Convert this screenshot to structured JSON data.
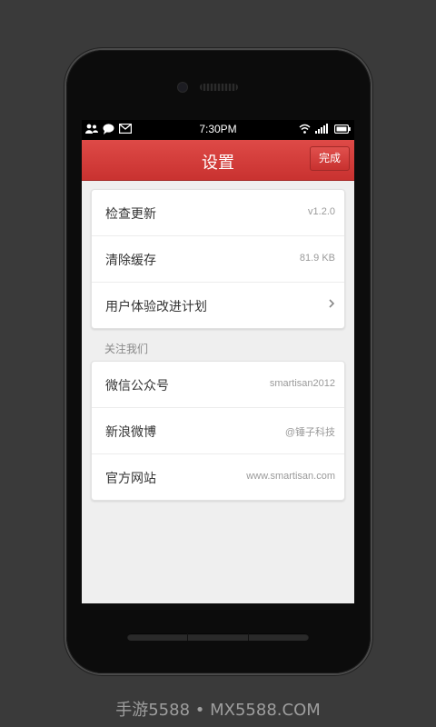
{
  "status_bar": {
    "time": "7:30PM",
    "left_icons": [
      "contacts-icon",
      "message-icon",
      "mail-icon"
    ],
    "right_icons": [
      "wifi-icon",
      "signal-icon",
      "battery-icon"
    ]
  },
  "titlebar": {
    "title": "设置",
    "done_label": "完成"
  },
  "general": {
    "items": [
      {
        "label": "检查更新",
        "value": "v1.2.0"
      },
      {
        "label": "清除缓存",
        "value": "81.9 KB"
      },
      {
        "label": "用户体验改进计划",
        "value": ""
      }
    ]
  },
  "follow": {
    "header": "关注我们",
    "items": [
      {
        "label": "微信公众号",
        "value": "smartisan2012"
      },
      {
        "label": "新浪微博",
        "value": "@锤子科技"
      },
      {
        "label": "官方网站",
        "value": "www.smartisan.com"
      }
    ]
  },
  "watermark": "手游5588 • MX5588.COM",
  "colors": {
    "accent": "#d13b38",
    "background": "#3a3a3a",
    "screen_bg": "#efefef"
  }
}
